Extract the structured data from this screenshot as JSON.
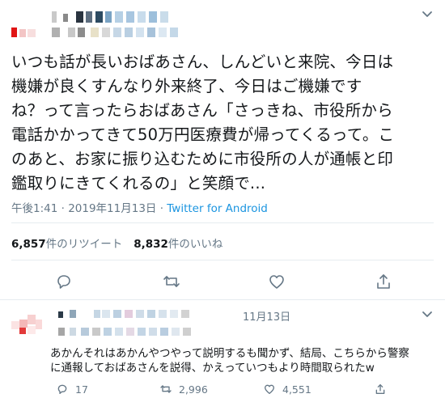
{
  "tweet": {
    "text_lines": [
      "いつも話が長いおばあさん、しんどいと来院、今日は",
      "機嫌が良くすんなり外来終了、今日はご機嫌です",
      "ね？って言ったらおばあさん「さっきね、市役所から",
      "電話かかってきて50万円医療費が帰ってくるって。こ",
      "のあと、お家に振り込むために市役所の人が通帳と印",
      "鑑取りにきてくれるの」と笑顔で..."
    ],
    "time": "午後1:41 · 2019年11月13日 · ",
    "source": "Twitter for Android",
    "retweets_count": "6,857",
    "retweets_label": "件のリツイート",
    "likes_count": "8,832",
    "likes_label": "件のいいね"
  },
  "reply": {
    "date": "11月13日",
    "text_lines": [
      "あかんそれはあかんやつやって説明するも聞かず、結局、こちらから警察",
      "に通報しておばあさんを説得、かえっていつもより時間取られたw"
    ],
    "reply_count": "17",
    "retweet_count": "2,996",
    "like_count": "4,551"
  },
  "colors": {
    "text": "#14171a",
    "secondary": "#657786",
    "link": "#1b95e0",
    "divider": "#e6ecf0",
    "icon": "#657786"
  },
  "icons": [
    "chevron-down-icon",
    "reply-icon",
    "retweet-icon",
    "like-icon",
    "share-icon"
  ]
}
